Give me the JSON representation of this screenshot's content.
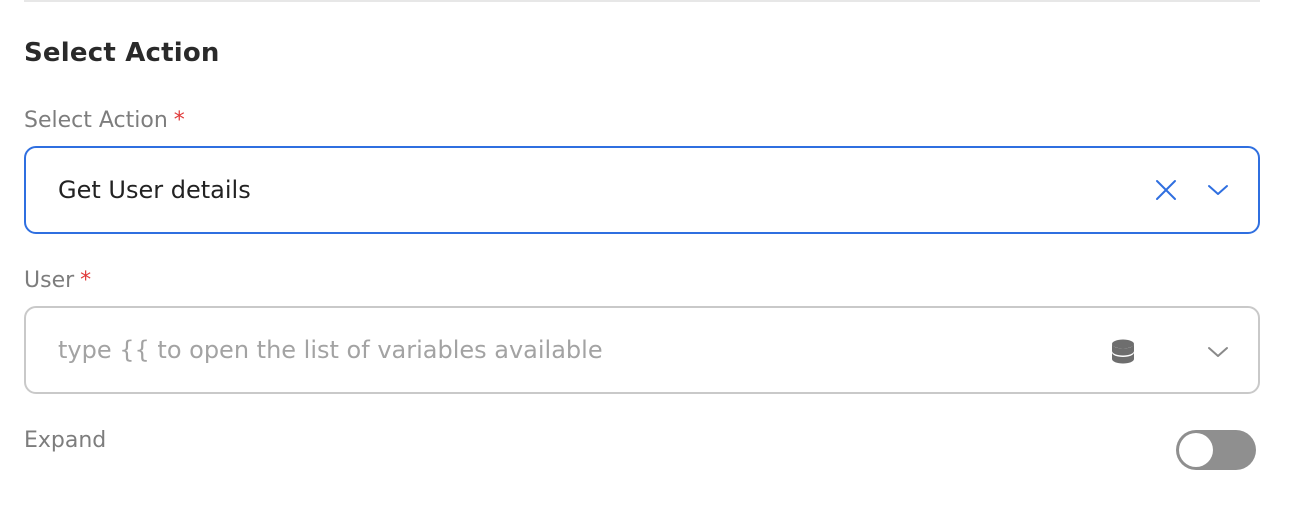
{
  "section": {
    "title": "Select Action"
  },
  "action_field": {
    "label": "Select Action",
    "required_mark": "*",
    "value": "Get User details",
    "clear_icon": "close-icon",
    "dropdown_icon": "chevron-down-icon",
    "accent_color": "#2f6fe0"
  },
  "user_field": {
    "label": "User",
    "required_mark": "*",
    "placeholder": "type {{ to open the list of variables available",
    "variable_icon": "database-icon",
    "dropdown_icon": "chevron-down-icon"
  },
  "expand": {
    "label": "Expand",
    "enabled": false
  }
}
